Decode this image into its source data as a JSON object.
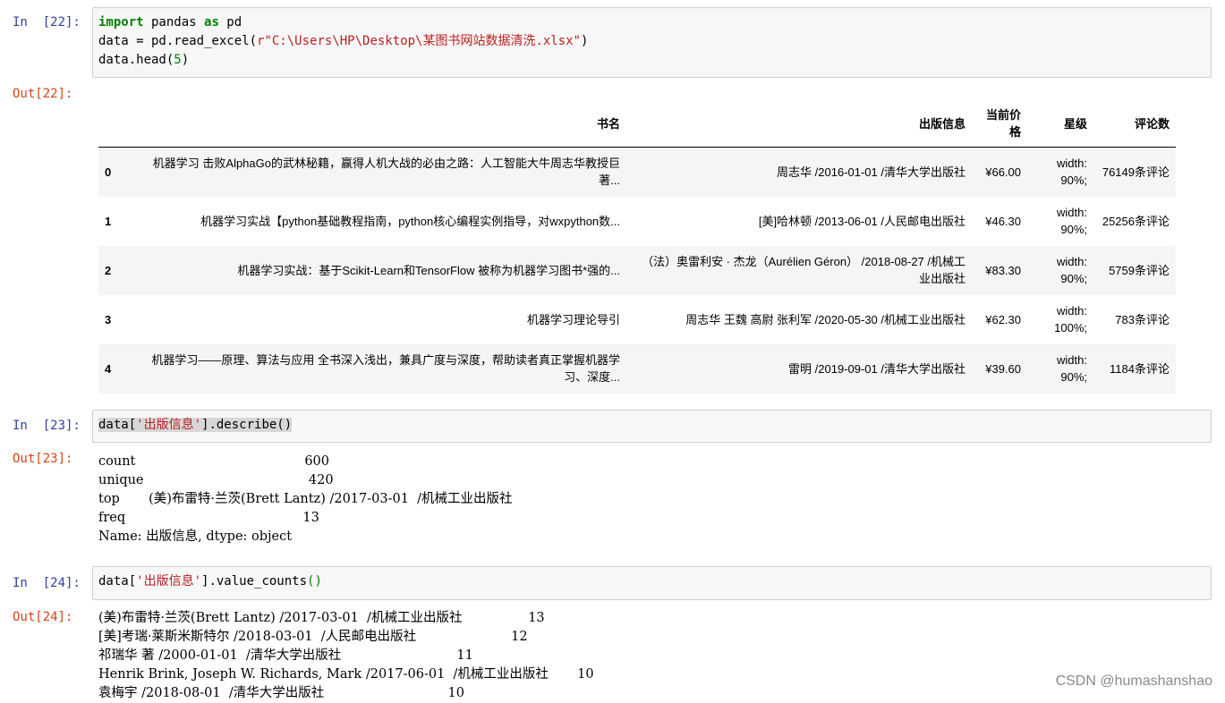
{
  "cell22": {
    "in_prompt": "In  [22]:",
    "out_prompt": "Out[22]:",
    "code": {
      "l1_kw1": "import",
      "l1_mod": " pandas ",
      "l1_kw2": "as",
      "l1_alias": " pd",
      "l2_a": "data = pd.read_excel(",
      "l2_str": "r\"C:\\Users\\HP\\Desktop\\某图书网站数据清洗.xlsx\"",
      "l2_b": ")",
      "l3_a": "data.head(",
      "l3_num": "5",
      "l3_b": ")"
    },
    "table": {
      "columns": [
        "",
        "书名",
        "出版信息",
        "当前价格",
        "星级",
        "评论数"
      ],
      "rows": [
        {
          "idx": "0",
          "title": "机器学习 击败AlphaGo的武林秘籍，赢得人机大战的必由之路：人工智能大牛周志华教授巨著...",
          "pub": "周志华 /2016-01-01 /清华大学出版社",
          "price": "¥66.00",
          "star": "width: 90%;",
          "comments": "76149条评论"
        },
        {
          "idx": "1",
          "title": "机器学习实战【python基础教程指南，python核心编程实例指导，对wxpython数...",
          "pub": "[美]哈林顿 /2013-06-01 /人民邮电出版社",
          "price": "¥46.30",
          "star": "width: 90%;",
          "comments": "25256条评论"
        },
        {
          "idx": "2",
          "title": "机器学习实战：基于Scikit-Learn和TensorFlow 被称为机器学习图书*强的...",
          "pub": "（法）奥雷利安 · 杰龙（Aurélien Géron） /2018-08-27 /机械工业出版社",
          "price": "¥83.30",
          "star": "width: 90%;",
          "comments": "5759条评论"
        },
        {
          "idx": "3",
          "title": "机器学习理论导引",
          "pub": "周志华 王魏 高尉 张利军 /2020-05-30 /机械工业出版社",
          "price": "¥62.30",
          "star": "width: 100%;",
          "comments": "783条评论"
        },
        {
          "idx": "4",
          "title": "机器学习——原理、算法与应用 全书深入浅出，兼具广度与深度，帮助读者真正掌握机器学习、深度...",
          "pub": "雷明 /2019-09-01 /清华大学出版社",
          "price": "¥39.60",
          "star": "width: 90%;",
          "comments": "1184条评论"
        }
      ]
    }
  },
  "cell23": {
    "in_prompt": "In  [23]:",
    "out_prompt": "Out[23]:",
    "code": {
      "a": "data[",
      "str": "'出版信息'",
      "b": "].describe()"
    },
    "output": [
      "count                                         600",
      "unique                                        420",
      "top       (美)布雷特·兰茨(Brett Lantz) /2017-03-01  /机械工业出版社",
      "freq                                           13",
      "Name: 出版信息, dtype: object"
    ]
  },
  "cell24": {
    "in_prompt": "In  [24]:",
    "out_prompt": "Out[24]:",
    "code": {
      "a": "data[",
      "str": "'出版信息'",
      "b": "].value_counts",
      "paren": "()"
    },
    "output": [
      "(美)布雷特·兰茨(Brett Lantz) /2017-03-01  /机械工业出版社                13",
      "[美]考瑞·莱斯米斯特尔 /2018-03-01  /人民邮电出版社                       12",
      "祁瑞华 著 /2000-01-01  /清华大学出版社                            11",
      "Henrik Brink, Joseph W. Richards, Mark /2017-06-01  /机械工业出版社       10",
      "袁梅宇 /2018-08-01  /清华大学出版社                              10"
    ]
  },
  "watermark": "CSDN @humashanshao"
}
